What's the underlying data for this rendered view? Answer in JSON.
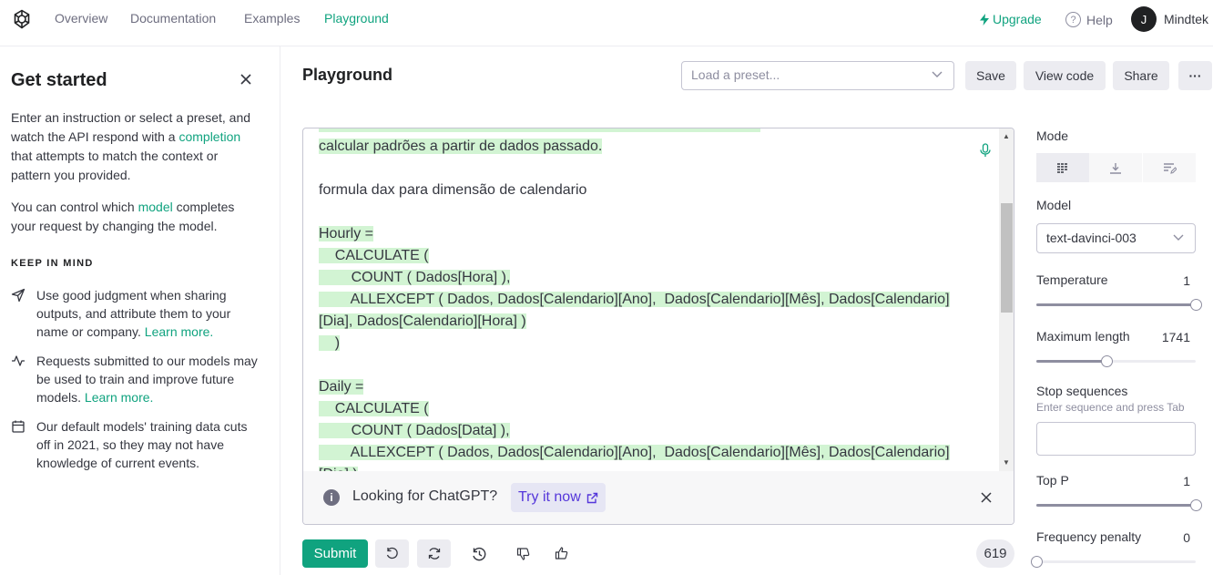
{
  "nav": {
    "links": [
      "Overview",
      "Documentation",
      "Examples",
      "Playground"
    ],
    "upgrade": "Upgrade",
    "help": "Help",
    "avatar_initial": "J",
    "user": "Mindtek"
  },
  "sidebar": {
    "title": "Get started",
    "intro_part1": "Enter an instruction or select a preset, and watch the API respond with a ",
    "intro_link": "completion",
    "intro_part2": " that attempts to match the context or pattern you provided.",
    "model_part1": "You can control which ",
    "model_link": "model",
    "model_part2": " completes your request by changing the model.",
    "keep_in_mind": "KEEP IN MIND",
    "tips": [
      {
        "text": "Use good judgment when sharing outputs, and attribute them to your name or company. ",
        "link": "Learn more.",
        "icon": "send-icon"
      },
      {
        "text": "Requests submitted to our models may be used to train and improve future models. ",
        "link": "Learn more.",
        "icon": "activity-icon"
      },
      {
        "text": "Our default models' training data cuts off in 2021, so they may not have knowledge of current events.",
        "link": "",
        "icon": "calendar-icon"
      }
    ]
  },
  "main": {
    "title": "Playground",
    "preset_placeholder": "Load a preset...",
    "save": "Save",
    "view_code": "View code",
    "share": "Share",
    "more": "···"
  },
  "editor": {
    "lines": [
      {
        "text": "calcular padrões a partir de dados passado.",
        "hl": true
      },
      {
        "text": "",
        "hl": false
      },
      {
        "text": "formula dax para dimensão de calendario",
        "hl": false
      },
      {
        "text": "",
        "hl": false
      },
      {
        "text": "Hourly =",
        "hl": true
      },
      {
        "text": "    CALCULATE (",
        "hl": true
      },
      {
        "text": "        COUNT ( Dados[Hora] ),",
        "hl": true
      },
      {
        "text": "        ALLEXCEPT ( Dados, Dados[Calendario][Ano],  Dados[Calendario][Mês], Dados[Calendario]",
        "hl": true
      },
      {
        "text": "[Dia], Dados[Calendario][Hora] )",
        "hl": true
      },
      {
        "text": "    )",
        "hl": true
      },
      {
        "text": "",
        "hl": false
      },
      {
        "text": "Daily =",
        "hl": true
      },
      {
        "text": "    CALCULATE (",
        "hl": true
      },
      {
        "text": "        COUNT ( Dados[Data] ),",
        "hl": true
      },
      {
        "text": "        ALLEXCEPT ( Dados, Dados[Calendario][Ano],  Dados[Calendario][Mês], Dados[Calendario]",
        "hl": true
      },
      {
        "text": "[Dia] )",
        "hl": true
      }
    ]
  },
  "chatgpt_banner": {
    "text": "Looking for ChatGPT?",
    "link": "Try it now"
  },
  "footer": {
    "submit": "Submit",
    "token_count": "619"
  },
  "settings": {
    "mode_label": "Mode",
    "model_label": "Model",
    "model_value": "text-davinci-003",
    "temperature_label": "Temperature",
    "temperature_value": "1",
    "temperature_fraction": 1.0,
    "max_length_label": "Maximum length",
    "max_length_value": "1741",
    "max_length_fraction": 0.438,
    "stop_label": "Stop sequences",
    "stop_hint": "Enter sequence and press Tab",
    "top_p_label": "Top P",
    "top_p_value": "1",
    "top_p_fraction": 1.0,
    "freq_label": "Frequency penalty",
    "freq_value": "0",
    "freq_fraction": 0.0
  },
  "colors": {
    "brand": "#10a37f",
    "highlight": "#d2f4d3",
    "link_purple": "#5436da"
  }
}
